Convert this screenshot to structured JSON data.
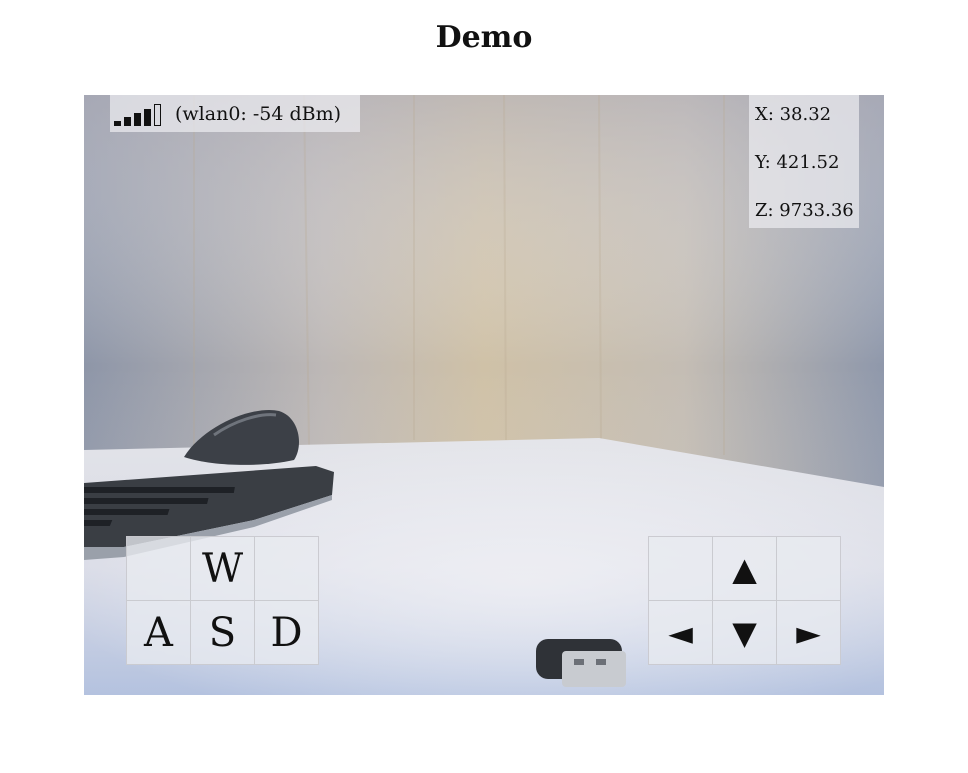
{
  "page": {
    "title": "Demo"
  },
  "signal": {
    "bars_filled": 4,
    "bars_total": 5,
    "text": "(wlan0: -54 dBm)"
  },
  "coords": {
    "x": "X: 38.32",
    "y": "Y: 421.52",
    "z": "Z: 9733.36"
  },
  "wasd": {
    "w": "W",
    "a": "A",
    "s": "S",
    "d": "D"
  },
  "arrows": {
    "up": "▲",
    "left": "◄",
    "down": "▼",
    "right": "►"
  }
}
